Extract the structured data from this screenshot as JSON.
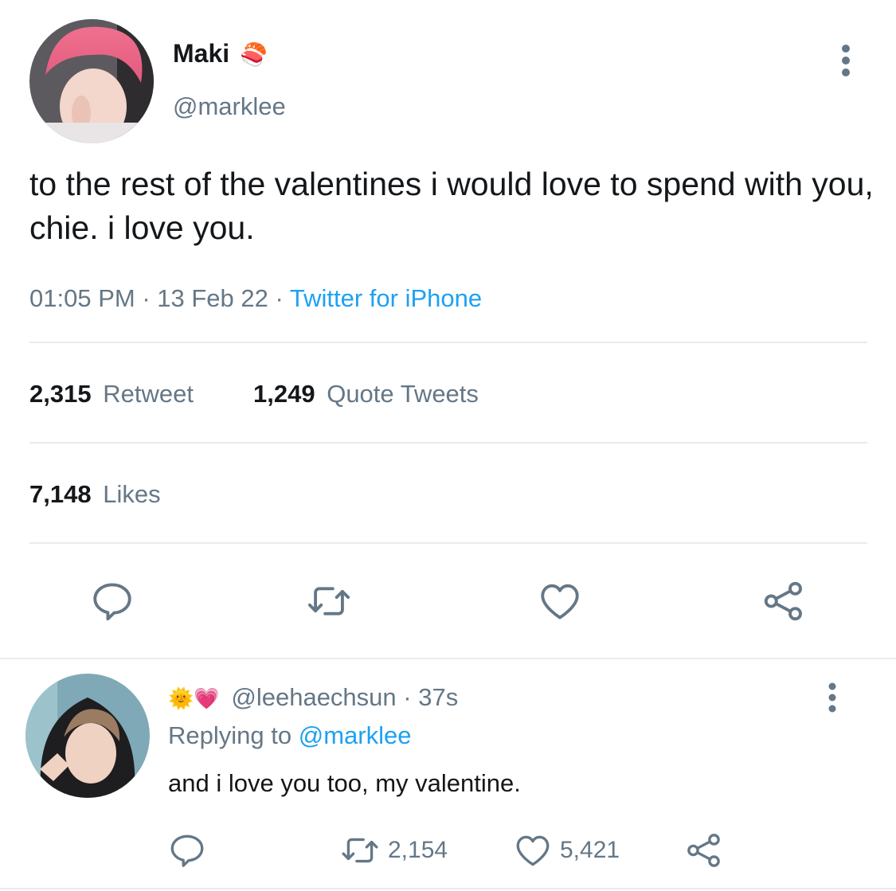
{
  "tweet": {
    "author_name": "Maki",
    "author_emoji": "🍣",
    "handle": "@marklee",
    "text": "to the rest of the valentines i would love to spend with you, chie. i love you.",
    "time": "01:05 PM",
    "date": "13 Feb 22",
    "source": "Twitter for iPhone",
    "retweets_count": "2,315",
    "retweets_label": "Retweet",
    "quotes_count": "1,249",
    "quotes_label": "Quote Tweets",
    "likes_count": "7,148",
    "likes_label": "Likes"
  },
  "reply": {
    "emojis": "🌞💗",
    "handle": "@leehaechsun",
    "time_ago": "37s",
    "replying_label": "Replying to",
    "replying_handle": "@marklee",
    "text": "and i love you too, my valentine.",
    "retweets": "2,154",
    "likes": "5,421"
  },
  "colors": {
    "text": "#14171a",
    "secondary": "#657786",
    "accent": "#1da1f2",
    "divider": "#e6ecf0"
  }
}
